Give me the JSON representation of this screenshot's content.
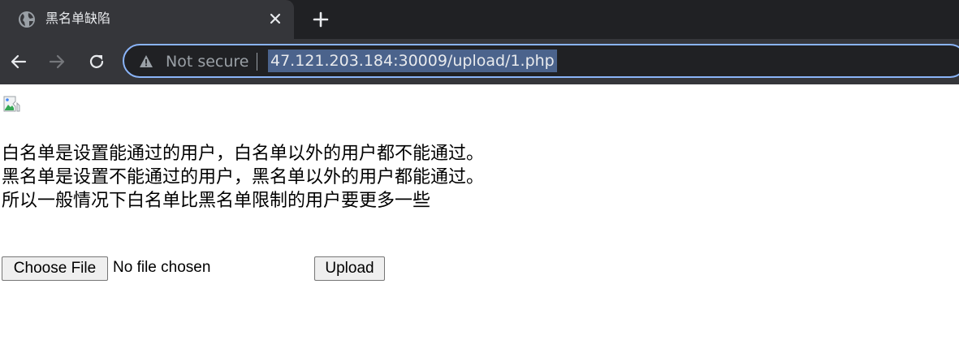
{
  "tab": {
    "title": "黑名单缺陷",
    "favicon": "globe-icon"
  },
  "toolbar": {
    "security_label": "Not secure",
    "url": "47.121.203.184:30009/upload/1.php"
  },
  "page": {
    "image_icon": "broken-image-icon",
    "lines": [
      "白名单是设置能通过的用户，白名单以外的用户都不能通过。",
      "黑名单是设置不能通过的用户，黑名单以外的用户都能通过。",
      "所以一般情况下白名单比黑名单限制的用户要更多一些"
    ],
    "choose_file_label": "Choose File",
    "no_file_text": "No file chosen",
    "upload_label": "Upload"
  },
  "colors": {
    "tabstrip_bg": "#202124",
    "toolbar_bg": "#35363a",
    "omnibox_border": "#8ab4f8",
    "url_selection": "#4b638c"
  }
}
